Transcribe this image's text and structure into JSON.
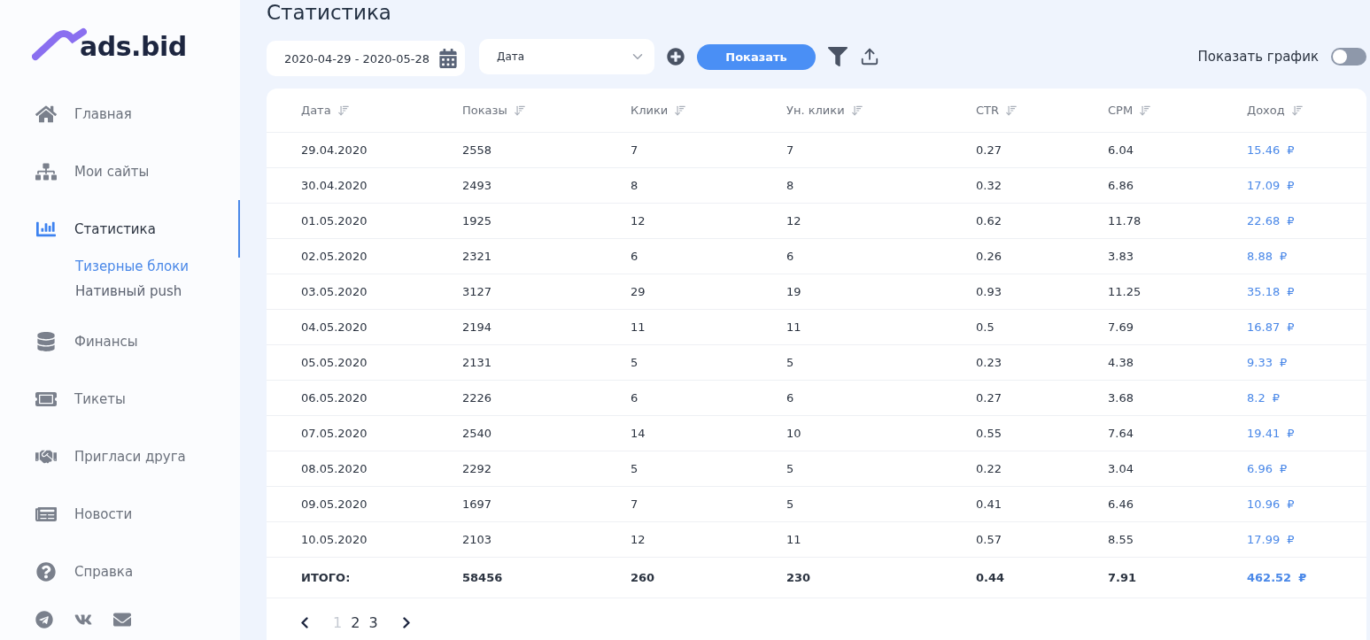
{
  "logo": {
    "text": "ads.bid"
  },
  "sidebar": {
    "items": [
      {
        "label": "Главная",
        "selected": false
      },
      {
        "label": "Мои сайты",
        "selected": false
      },
      {
        "label": "Статистика",
        "selected": true,
        "children": [
          {
            "label": "Тизерные блоки",
            "selected": true
          },
          {
            "label": "Нативный push",
            "selected": false
          }
        ]
      },
      {
        "label": "Финансы",
        "selected": false
      },
      {
        "label": "Тикеты",
        "selected": false
      },
      {
        "label": "Пригласи друга",
        "selected": false
      },
      {
        "label": "Новости",
        "selected": false
      },
      {
        "label": "Справка",
        "selected": false
      }
    ]
  },
  "page_title": "Статистика",
  "toolbar": {
    "date_range": "2020-04-29 - 2020-05-28",
    "group_select": "Дата",
    "show_button": "Показать",
    "chart_toggle": {
      "label": "Показать график",
      "on": false
    }
  },
  "table": {
    "columns": [
      "Дата",
      "Показы",
      "Клики",
      "Ун. клики",
      "CTR",
      "CPM",
      "Доход"
    ],
    "rows": [
      {
        "cells": [
          "29.04.2020",
          "2558",
          "7",
          "7",
          "0.27",
          "6.04"
        ],
        "income": "15.46",
        "currency": "₽"
      },
      {
        "cells": [
          "30.04.2020",
          "2493",
          "8",
          "8",
          "0.32",
          "6.86"
        ],
        "income": "17.09",
        "currency": "₽"
      },
      {
        "cells": [
          "01.05.2020",
          "1925",
          "12",
          "12",
          "0.62",
          "11.78"
        ],
        "income": "22.68",
        "currency": "₽"
      },
      {
        "cells": [
          "02.05.2020",
          "2321",
          "6",
          "6",
          "0.26",
          "3.83"
        ],
        "income": "8.88",
        "currency": "₽"
      },
      {
        "cells": [
          "03.05.2020",
          "3127",
          "29",
          "19",
          "0.93",
          "11.25"
        ],
        "income": "35.18",
        "currency": "₽"
      },
      {
        "cells": [
          "04.05.2020",
          "2194",
          "11",
          "11",
          "0.5",
          "7.69"
        ],
        "income": "16.87",
        "currency": "₽"
      },
      {
        "cells": [
          "05.05.2020",
          "2131",
          "5",
          "5",
          "0.23",
          "4.38"
        ],
        "income": "9.33",
        "currency": "₽"
      },
      {
        "cells": [
          "06.05.2020",
          "2226",
          "6",
          "6",
          "0.27",
          "3.68"
        ],
        "income": "8.2",
        "currency": "₽"
      },
      {
        "cells": [
          "07.05.2020",
          "2540",
          "14",
          "10",
          "0.55",
          "7.64"
        ],
        "income": "19.41",
        "currency": "₽"
      },
      {
        "cells": [
          "08.05.2020",
          "2292",
          "5",
          "5",
          "0.22",
          "3.04"
        ],
        "income": "6.96",
        "currency": "₽"
      },
      {
        "cells": [
          "09.05.2020",
          "1697",
          "7",
          "5",
          "0.41",
          "6.46"
        ],
        "income": "10.96",
        "currency": "₽"
      },
      {
        "cells": [
          "10.05.2020",
          "2103",
          "12",
          "11",
          "0.57",
          "8.55"
        ],
        "income": "17.99",
        "currency": "₽"
      }
    ],
    "total": {
      "cells": [
        "ИТОГО:",
        "58456",
        "260",
        "230",
        "0.44",
        "7.91"
      ],
      "income": "462.52",
      "currency": "₽"
    }
  },
  "pagination": {
    "pages": [
      {
        "label": "1",
        "selected": true
      },
      {
        "label": "2",
        "selected": false
      },
      {
        "label": "3",
        "selected": false
      }
    ]
  }
}
